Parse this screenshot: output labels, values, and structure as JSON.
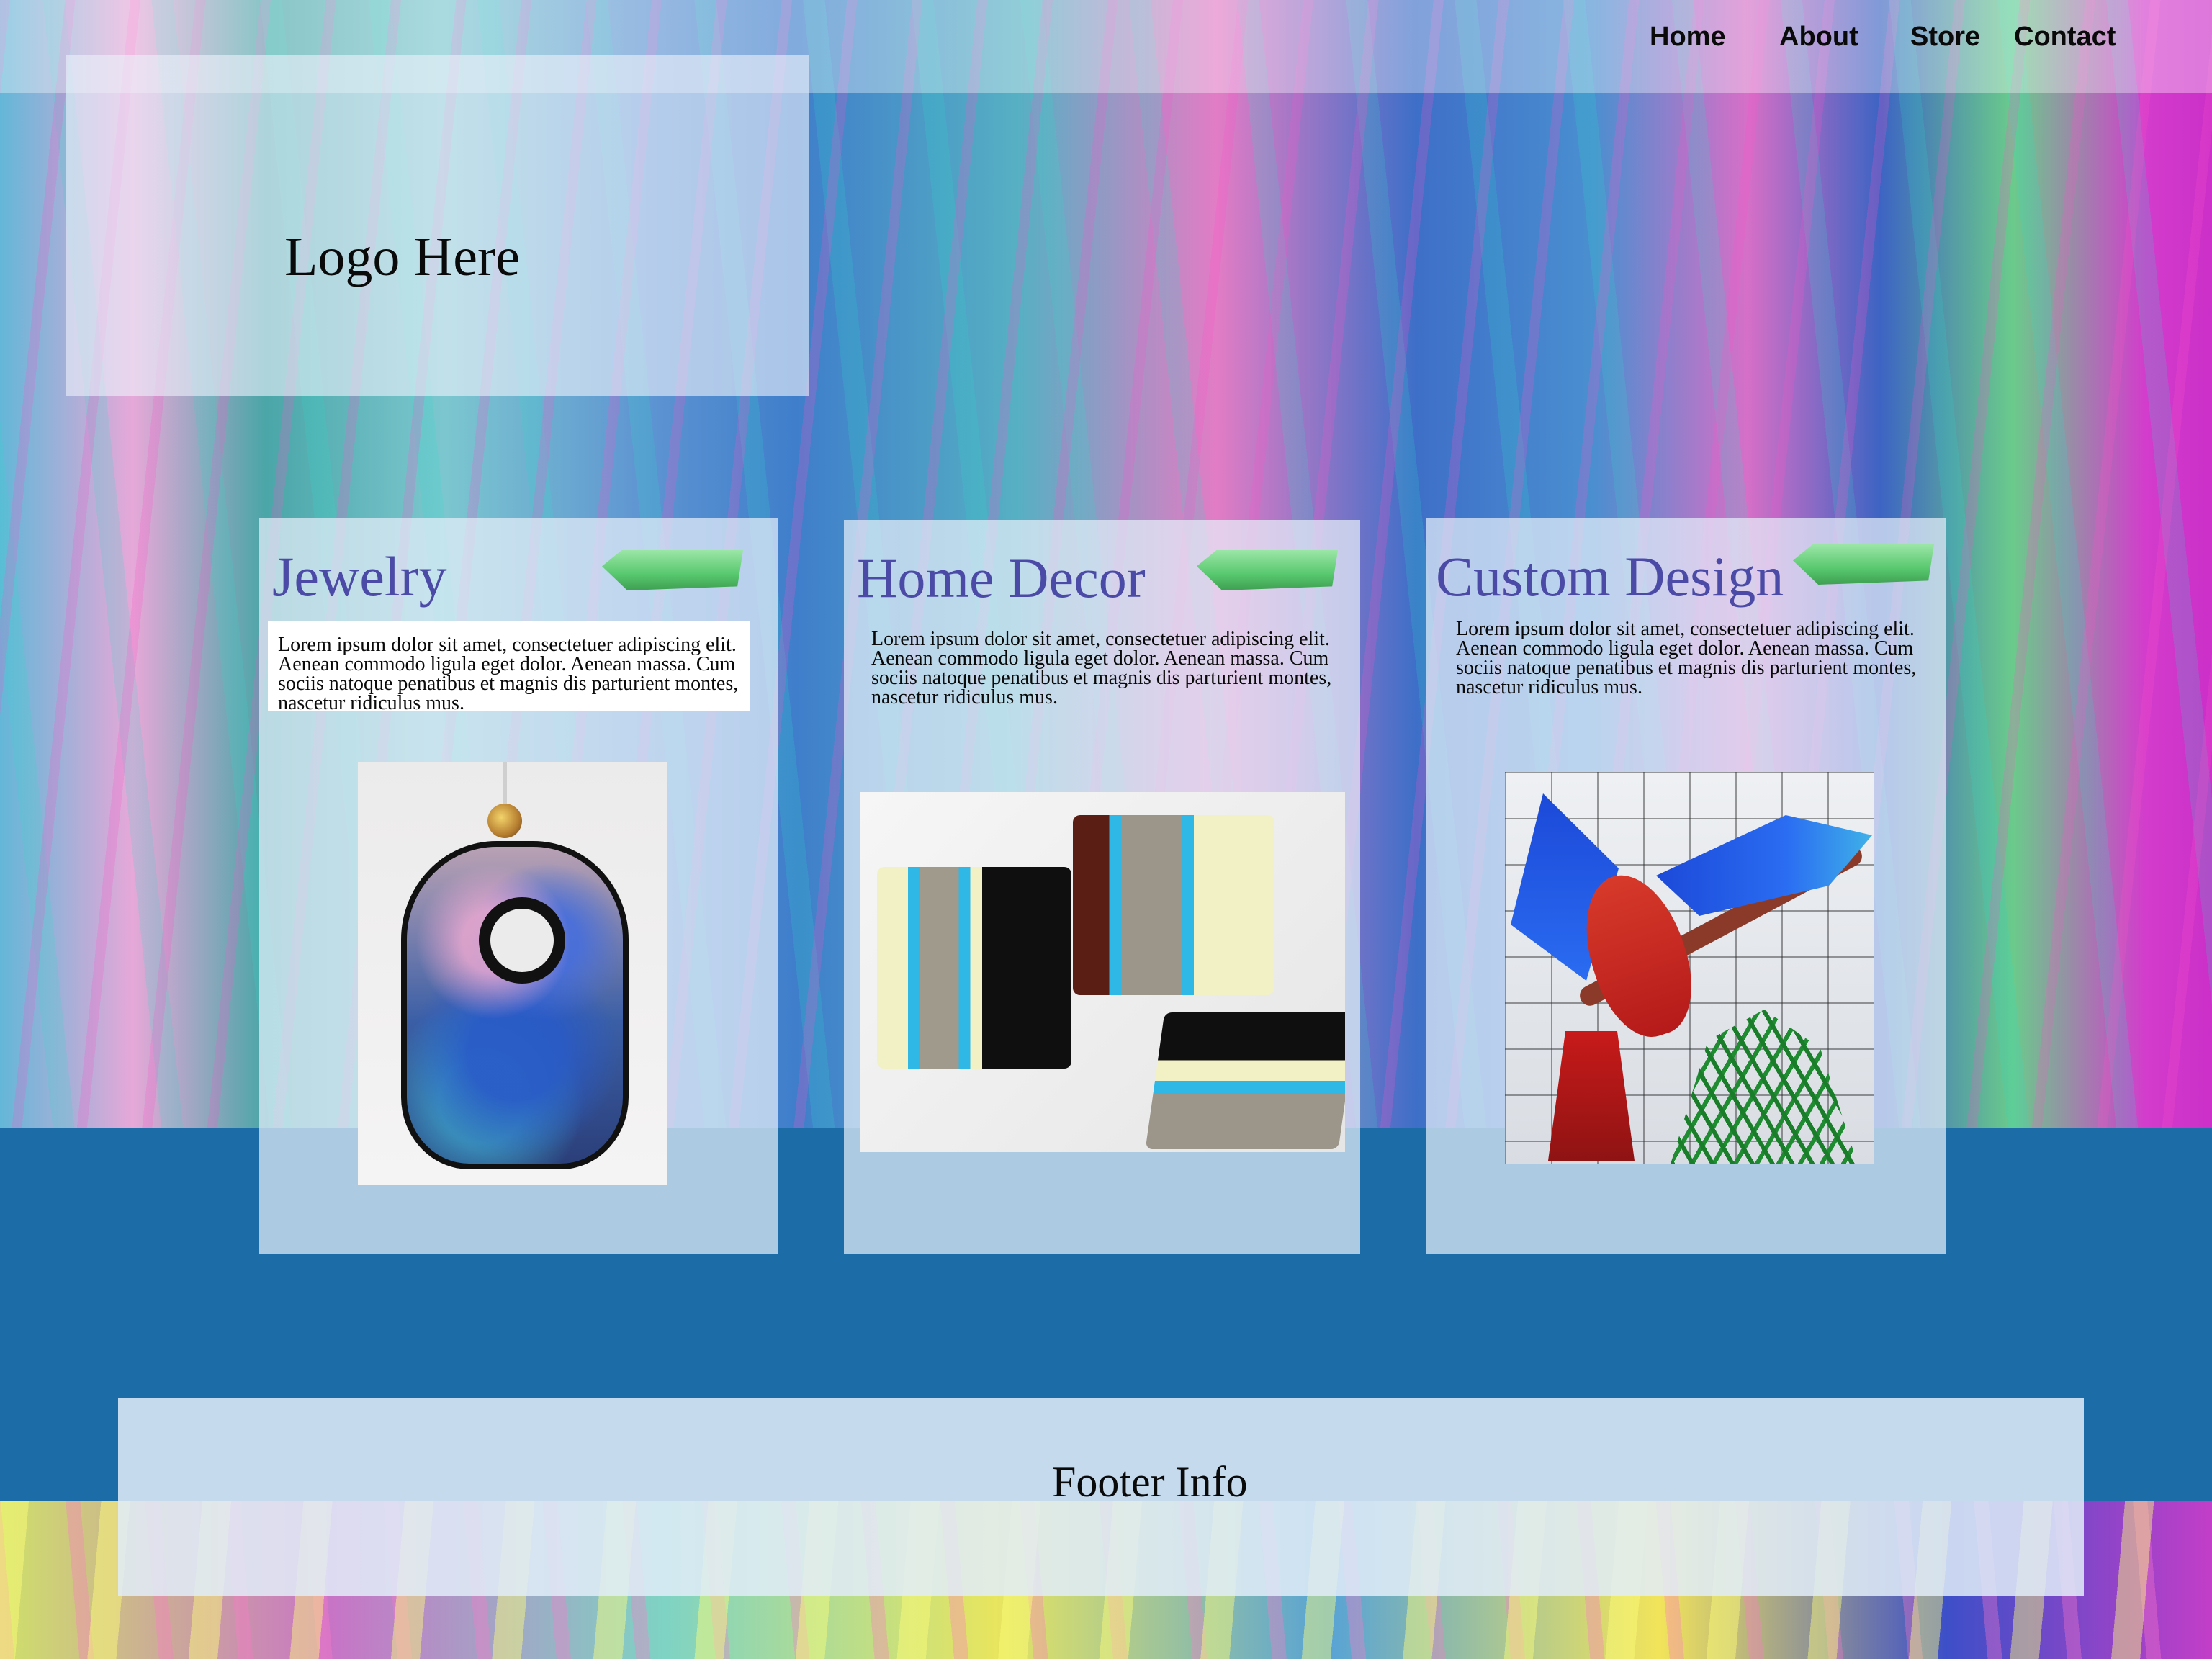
{
  "nav": {
    "items": [
      {
        "label": "Home"
      },
      {
        "label": "About"
      },
      {
        "label": "Store"
      },
      {
        "label": "Contact"
      }
    ]
  },
  "logo": {
    "text": "Logo Here"
  },
  "cards": [
    {
      "title": "Jewelry",
      "body": "Lorem ipsum dolor sit amet, consectetuer adipiscing elit. Aenean commodo ligula eget dolor. Aenean massa. Cum sociis natoque penatibus et magnis dis parturient montes, nascetur ridiculus mus."
    },
    {
      "title": "Home Decor",
      "body": "Lorem ipsum dolor sit amet, consectetuer adipiscing elit. Aenean commodo ligula eget dolor. Aenean massa. Cum sociis natoque penatibus et magnis dis parturient montes, nascetur ridiculus mus."
    },
    {
      "title": "Custom Design",
      "body": "Lorem ipsum dolor sit amet, consectetuer adipiscing elit. Aenean commodo ligula eget dolor. Aenean massa. Cum sociis natoque penatibus et magnis dis parturient montes, nascetur ridiculus mus."
    }
  ],
  "footer": {
    "text": "Footer Info"
  },
  "colors": {
    "card_title": "#4b4aa6",
    "band_blue": "#1c6ca8",
    "tab_green": "#58c86e"
  }
}
